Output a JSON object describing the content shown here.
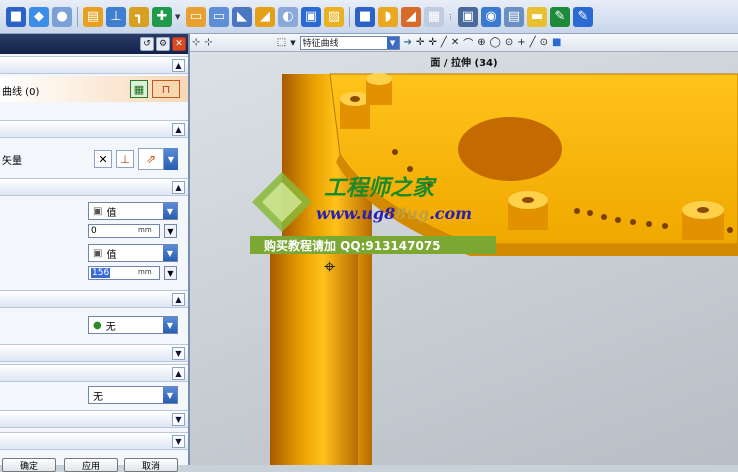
{
  "toolbar": {
    "icons": [
      "cube-icon",
      "sheet-icon",
      "sphere-icon",
      "box-icon",
      "hole-icon",
      "align-icon",
      "constraint-icon",
      "dropdown-icon",
      "cylinder-icon",
      "tube-icon",
      "chamfer-icon",
      "extrude-icon",
      "blend-icon",
      "shell-icon",
      "offset-icon",
      "pattern-icon",
      "draft-icon",
      "layer-icon",
      "view-icon",
      "edit-icon",
      "analysis-icon",
      "tag-icon"
    ]
  },
  "panel": {
    "section1_label": "曲线 (0)",
    "section2_label": "矢量",
    "limit_start_type": "值",
    "limit_start_value": "0",
    "limit_end_type": "值",
    "limit_end_value": "156",
    "unit": "mm",
    "boolean_value": "无",
    "offset_value": "无",
    "ok_label": "确定",
    "apply_label": "应用",
    "cancel_label": "取消"
  },
  "viewport": {
    "filter_label": "特征曲线",
    "selection_info": "面 / 拉伸 (34)"
  },
  "watermark": {
    "title": "工程师之家",
    "url": "www.ug8",
    "url_tail": ".com",
    "ad": "购买教程请加 QQ:913147075"
  },
  "colors": {
    "part": "#f2b400",
    "part_dark": "#c27a00",
    "panel_bg": "#f3f6fb",
    "title_bar": "#13224a"
  }
}
